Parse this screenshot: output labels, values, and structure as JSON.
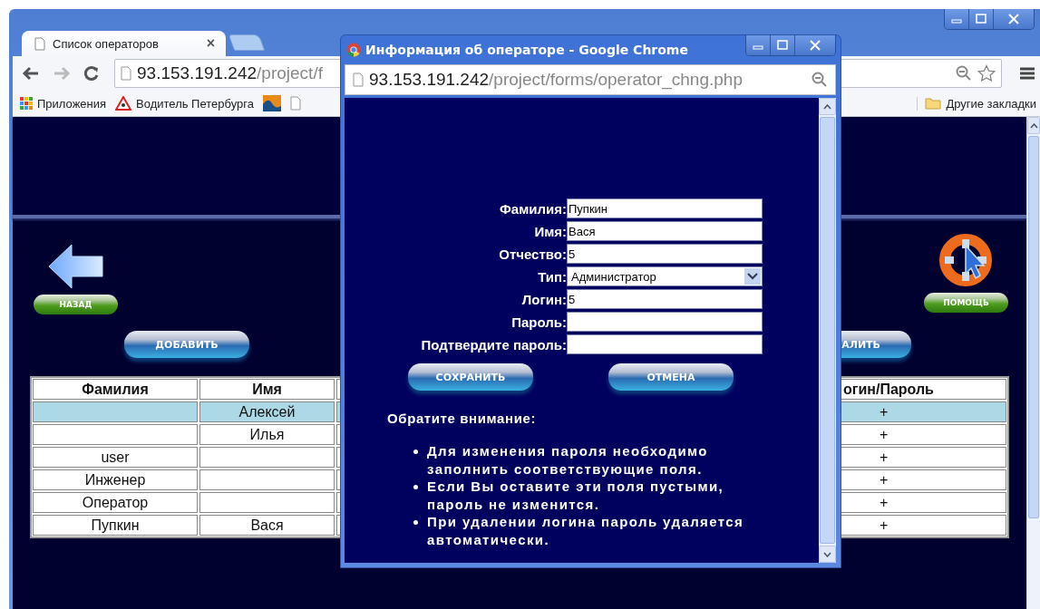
{
  "browser": {
    "tab": {
      "title": "Список операторов",
      "close": "×"
    },
    "address": {
      "host": "93.153.191.242",
      "path": "/project/f"
    },
    "bookmarks": [
      {
        "kind": "apps",
        "label": "Приложения"
      },
      {
        "kind": "warning",
        "label": "Водитель Петербурга"
      },
      {
        "kind": "chart"
      },
      {
        "kind": "page"
      }
    ],
    "other_bookmarks": "Другие закладки"
  },
  "page": {
    "back_button": "НАЗАД",
    "help_button": "ПОМОЩЬ",
    "add_button": "ДОБАВИТЬ",
    "delete_button": "АЛИТЬ",
    "table": {
      "columns": [
        "Фамилия",
        "Имя",
        "огин/Пароль"
      ],
      "rows": [
        {
          "name": "Алексей",
          "login_password": "+",
          "selected": true
        },
        {
          "name": "Илья",
          "login_password": "+",
          "selected": false
        },
        {
          "surname": "user",
          "login_password": "+",
          "selected": false
        },
        {
          "surname": "Инженер",
          "login_password": "+",
          "selected": false
        },
        {
          "surname": "Оператор",
          "login_password": "+",
          "selected": false
        },
        {
          "surname": "Пупкин",
          "name": "Вася",
          "login_password": "+",
          "selected": false
        }
      ]
    }
  },
  "popup": {
    "title": "Информация об операторе - Google Chrome",
    "address": {
      "host": "93.153.191.242",
      "path": "/project/forms/operator_chng.php"
    },
    "fields": [
      {
        "label": "Фамилия:",
        "kind": "text",
        "value": "Пупкин"
      },
      {
        "label": "Имя:",
        "kind": "text",
        "value": "Вася"
      },
      {
        "label": "Отчество:",
        "kind": "text",
        "value": "5"
      },
      {
        "label": "Тип:",
        "kind": "select",
        "value": "Администратор"
      },
      {
        "label": "Логин:",
        "kind": "text",
        "value": "5"
      },
      {
        "label": "Пароль:",
        "kind": "password"
      },
      {
        "label": "Подтвердите пароль:",
        "kind": "password"
      }
    ],
    "buttons": [
      "СОХРАНИТЬ",
      "ОТМЕНА"
    ],
    "note_title": "Обратите внимание:",
    "notes": [
      "Для изменения пароля необходимо заполнить соответствующие поля.",
      "Если Вы оставите эти поля пустыми, пароль не изменится.",
      "При удалении логина пароль удаляется автоматически."
    ]
  }
}
